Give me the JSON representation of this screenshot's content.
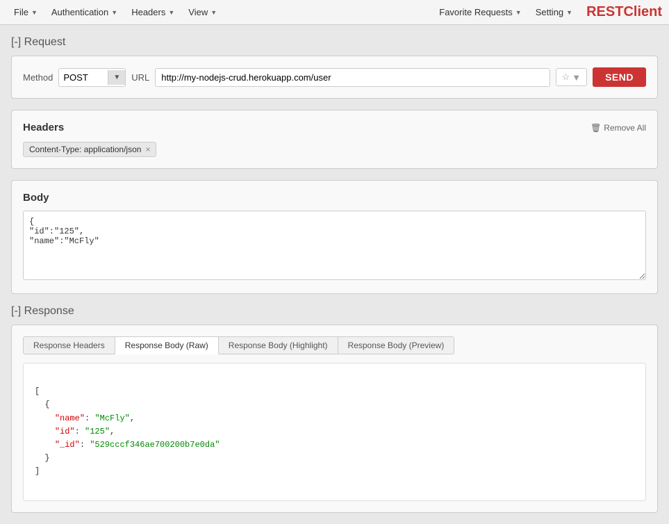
{
  "app": {
    "title_prefix": "REST",
    "title_suffix": "Client"
  },
  "menubar": {
    "file_label": "File",
    "auth_label": "Authentication",
    "headers_label": "Headers",
    "view_label": "View",
    "fav_label": "Favorite Requests",
    "setting_label": "Setting"
  },
  "request": {
    "section_label": "[-] Request",
    "method_label": "Method",
    "method_value": "POST",
    "url_label": "URL",
    "url_value": "http://my-nodejs-crud.herokuapp.com/user",
    "send_label": "SEND"
  },
  "headers": {
    "section_label": "Headers",
    "remove_all_label": "Remove All",
    "content_type_tag": "Content-Type: application/json"
  },
  "body": {
    "section_label": "Body",
    "content": "{\n\"id\":\"125\",\n\"name\":\"McFly\""
  },
  "response": {
    "section_label": "[-] Response",
    "tabs": [
      {
        "label": "Response Headers",
        "active": false
      },
      {
        "label": "Response Body (Raw)",
        "active": true
      },
      {
        "label": "Response Body (Highlight)",
        "active": false
      },
      {
        "label": "Response Body (Preview)",
        "active": false
      }
    ],
    "body": "[\n  {\n    \"name\": \"McFly\",\n    \"id\": \"125\",\n    \"_id\": \"529cccf346ae700200b7e0da\"\n  }\n]"
  }
}
